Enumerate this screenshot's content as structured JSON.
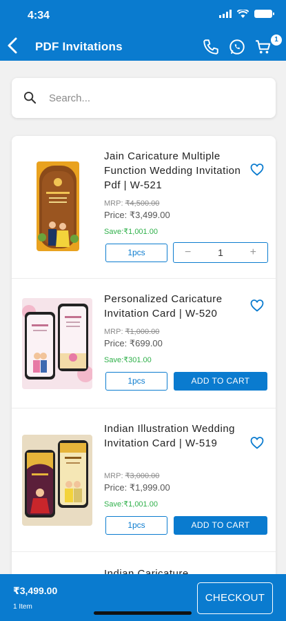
{
  "status": {
    "time": "4:34"
  },
  "header": {
    "title": "PDF Invitations",
    "cart_count": "1"
  },
  "search": {
    "placeholder": "Search..."
  },
  "products": [
    {
      "name": "Jain Caricature Multiple Function Wedding Invitation Pdf | W-521",
      "mrp_label": "MRP:",
      "mrp": "₹4,500.00",
      "price_label": "Price:",
      "price": "₹3,499.00",
      "save_label": "Save:",
      "save": "₹1,001.00",
      "unit": "1pcs",
      "qty": "1",
      "in_cart": true
    },
    {
      "name": "Personalized Caricature Invitation Card | W-520",
      "mrp_label": "MRP:",
      "mrp": "₹1,000.00",
      "price_label": "Price:",
      "price": "₹699.00",
      "save_label": "Save:",
      "save": "₹301.00",
      "unit": "1pcs",
      "button": "ADD TO CART",
      "in_cart": false
    },
    {
      "name": "Indian Illustration Wedding Invitation Card | W-519",
      "mrp_label": "MRP:",
      "mrp": "₹3,000.00",
      "price_label": "Price:",
      "price": "₹1,999.00",
      "save_label": "Save:",
      "save": "₹1,001.00",
      "unit": "1pcs",
      "button": "ADD TO CART",
      "in_cart": false
    },
    {
      "name": "Indian Caricature"
    }
  ],
  "footer": {
    "total": "₹3,499.00",
    "items": "1 Item",
    "checkout": "CHECKOUT"
  },
  "colors": {
    "primary": "#0a7bcf",
    "save_green": "#2fb04a"
  },
  "icons": [
    "back-icon",
    "phone-icon",
    "whatsapp-icon",
    "cart-icon",
    "search-icon",
    "heart-icon"
  ]
}
